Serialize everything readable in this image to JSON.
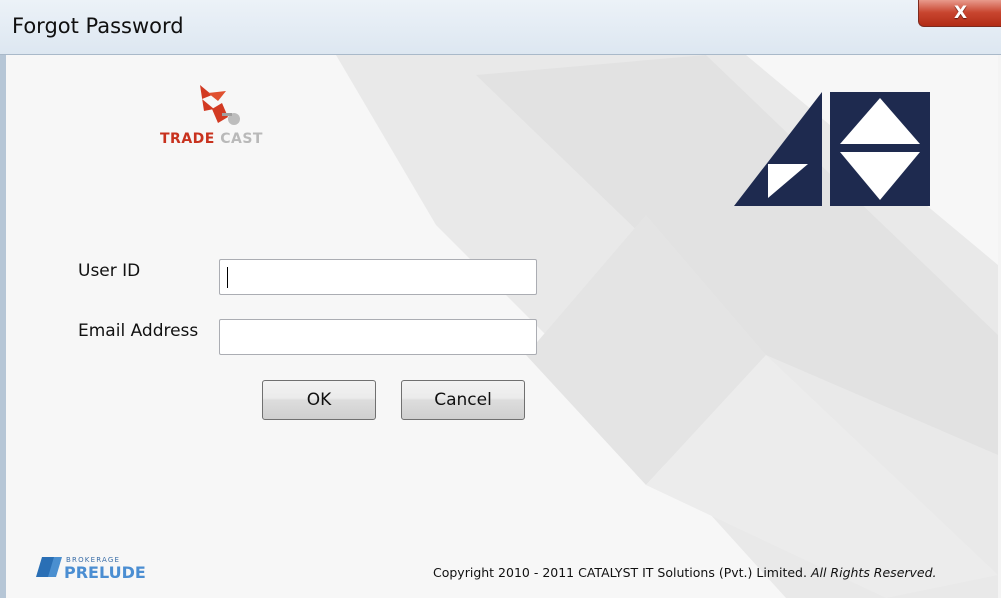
{
  "window": {
    "title": "Forgot Password",
    "close_label": "X"
  },
  "branding": {
    "tradecast_word1": "TRADE",
    "tradecast_word2": "CAST",
    "prelude_small": "BROKERAGE",
    "prelude_big": "PRELUDE"
  },
  "form": {
    "user_id_label": "User ID",
    "user_id_value": "",
    "email_label": "Email Address",
    "email_value": ""
  },
  "buttons": {
    "ok": "OK",
    "cancel": "Cancel"
  },
  "footer": {
    "copyright": "Copyright 2010 - 2011 CATALYST IT Solutions (Pvt.) Limited.",
    "rights": "All Rights Reserved."
  },
  "colors": {
    "navy": "#1e2a4f",
    "trade_red": "#c8321e",
    "close_red": "#c8452f"
  }
}
